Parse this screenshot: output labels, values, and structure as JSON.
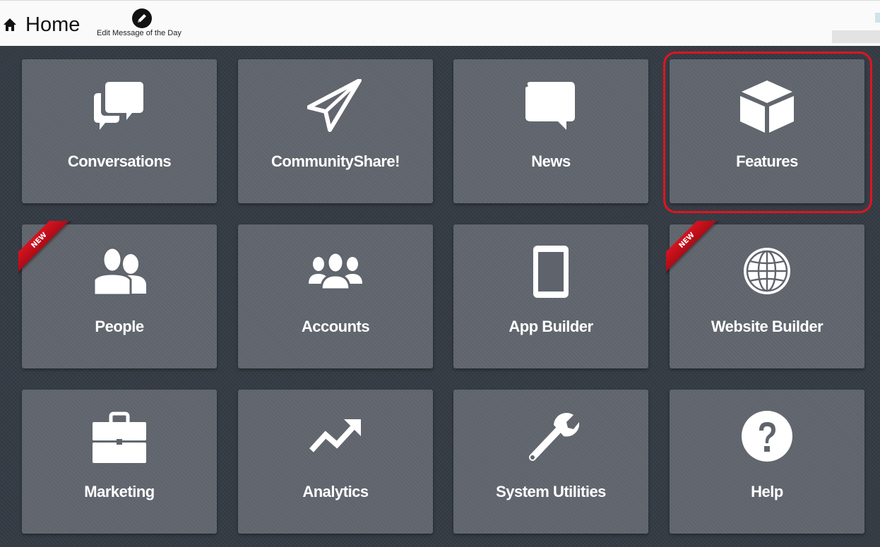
{
  "header": {
    "title": "Home",
    "home_icon": "home-icon",
    "motd_label": "Edit Message of the Day",
    "motd_icon": "pencil-circle-icon"
  },
  "tiles": [
    {
      "label": "Conversations",
      "icon": "chat-bubbles-icon"
    },
    {
      "label": "CommunityShare!",
      "icon": "paper-plane-icon"
    },
    {
      "label": "News",
      "icon": "speech-bubble-icon"
    },
    {
      "label": "Features",
      "icon": "cube-icon",
      "highlighted": true
    },
    {
      "label": "People",
      "icon": "two-people-icon",
      "badge": "NEW"
    },
    {
      "label": "Accounts",
      "icon": "group-icon"
    },
    {
      "label": "App Builder",
      "icon": "tablet-icon"
    },
    {
      "label": "Website Builder",
      "icon": "globe-icon",
      "badge": "NEW"
    },
    {
      "label": "Marketing",
      "icon": "briefcase-icon"
    },
    {
      "label": "Analytics",
      "icon": "trend-up-icon"
    },
    {
      "label": "System Utilities",
      "icon": "wrench-icon"
    },
    {
      "label": "Help",
      "icon": "question-circle-icon"
    }
  ],
  "colors": {
    "tile_bg": "#5f646c",
    "page_bg": "#353c45",
    "highlight": "#e0141f",
    "ribbon": "#d8121f"
  }
}
